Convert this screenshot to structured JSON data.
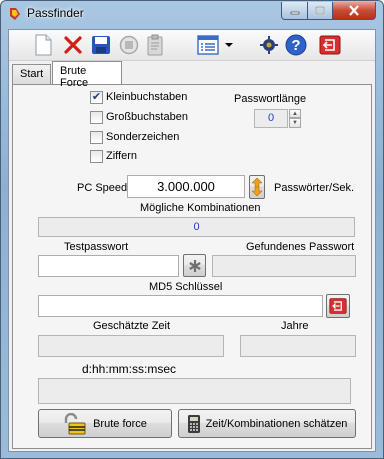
{
  "window": {
    "title": "Passfinder"
  },
  "tabs": [
    {
      "label": "Start"
    },
    {
      "label": "Brute Force"
    }
  ],
  "options": {
    "lowercase": {
      "label": "Kleinbuchstaben",
      "checked": true
    },
    "uppercase": {
      "label": "Großbuchstaben",
      "checked": false
    },
    "special": {
      "label": "Sonderzeichen",
      "checked": false
    },
    "digits": {
      "label": "Ziffern",
      "checked": false
    }
  },
  "password_length": {
    "label": "Passwortlänge",
    "value": "0"
  },
  "pc_speed": {
    "label": "PC Speed",
    "value": "3.000.000",
    "unit": "Passwörter/Sek."
  },
  "combinations": {
    "label": "Mögliche Kombinationen",
    "value": "0"
  },
  "test_password": {
    "label": "Testpasswort",
    "value": ""
  },
  "found_password": {
    "label": "Gefundenes Passwort",
    "value": ""
  },
  "md5": {
    "label": "MD5 Schlüssel",
    "value": ""
  },
  "estimated_time": {
    "label": "Geschätzte Zeit",
    "value": "",
    "format": "d:hh:mm:ss:msec"
  },
  "years": {
    "label": "Jahre",
    "value": ""
  },
  "buttons": {
    "brute_force": "Brute force",
    "estimate": "Zeit/Kombinationen schätzen"
  },
  "colors": {
    "accent_blue": "#1f3fbf",
    "title_bar": "#9bbbd9",
    "close_red": "#c74b33"
  },
  "icons": [
    "new-file-icon",
    "delete-icon",
    "save-icon",
    "stop-icon",
    "clipboard-icon",
    "list-view-icon",
    "settings-icon",
    "help-icon",
    "exit-icon"
  ]
}
